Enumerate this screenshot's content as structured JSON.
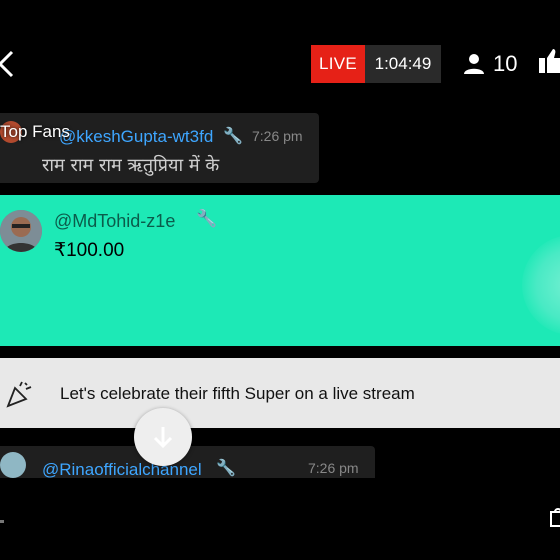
{
  "header": {
    "live_label": "LIVE",
    "elapsed": "1:04:49",
    "viewer_count": "10",
    "colors": {
      "live": "#e62117",
      "time_bg": "#2a2a2a"
    }
  },
  "top_fans": {
    "label": "Top Fans"
  },
  "chat": {
    "message1": {
      "author": "@kkeshGupta-wt3fd",
      "time": "7:26 pm",
      "text": "राम राम राम ऋतुप्रिया में के"
    },
    "message2": {
      "author": "@Rinaofficialchannel",
      "time": "7:26 pm"
    }
  },
  "super_chat": {
    "author": "@MdTohid-z1e",
    "amount": "₹100.00",
    "color": "#1de9b6"
  },
  "celebrate": {
    "text": "Let's celebrate their fifth Super on a live stream"
  },
  "icons": [
    "back-icon",
    "person-icon",
    "thumbs-up-icon",
    "wrench-icon",
    "party-popper-icon",
    "arrow-down-icon"
  ]
}
